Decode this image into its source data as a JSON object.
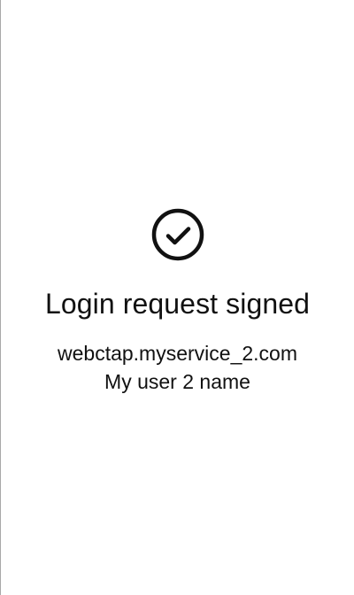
{
  "status": {
    "icon": "check-circle-icon",
    "title": "Login request signed",
    "service": "webctap.myservice_2.com",
    "user_name": "My user 2 name"
  },
  "colors": {
    "text": "#111111",
    "background": "#ffffff",
    "border": "#a8a8a8"
  }
}
